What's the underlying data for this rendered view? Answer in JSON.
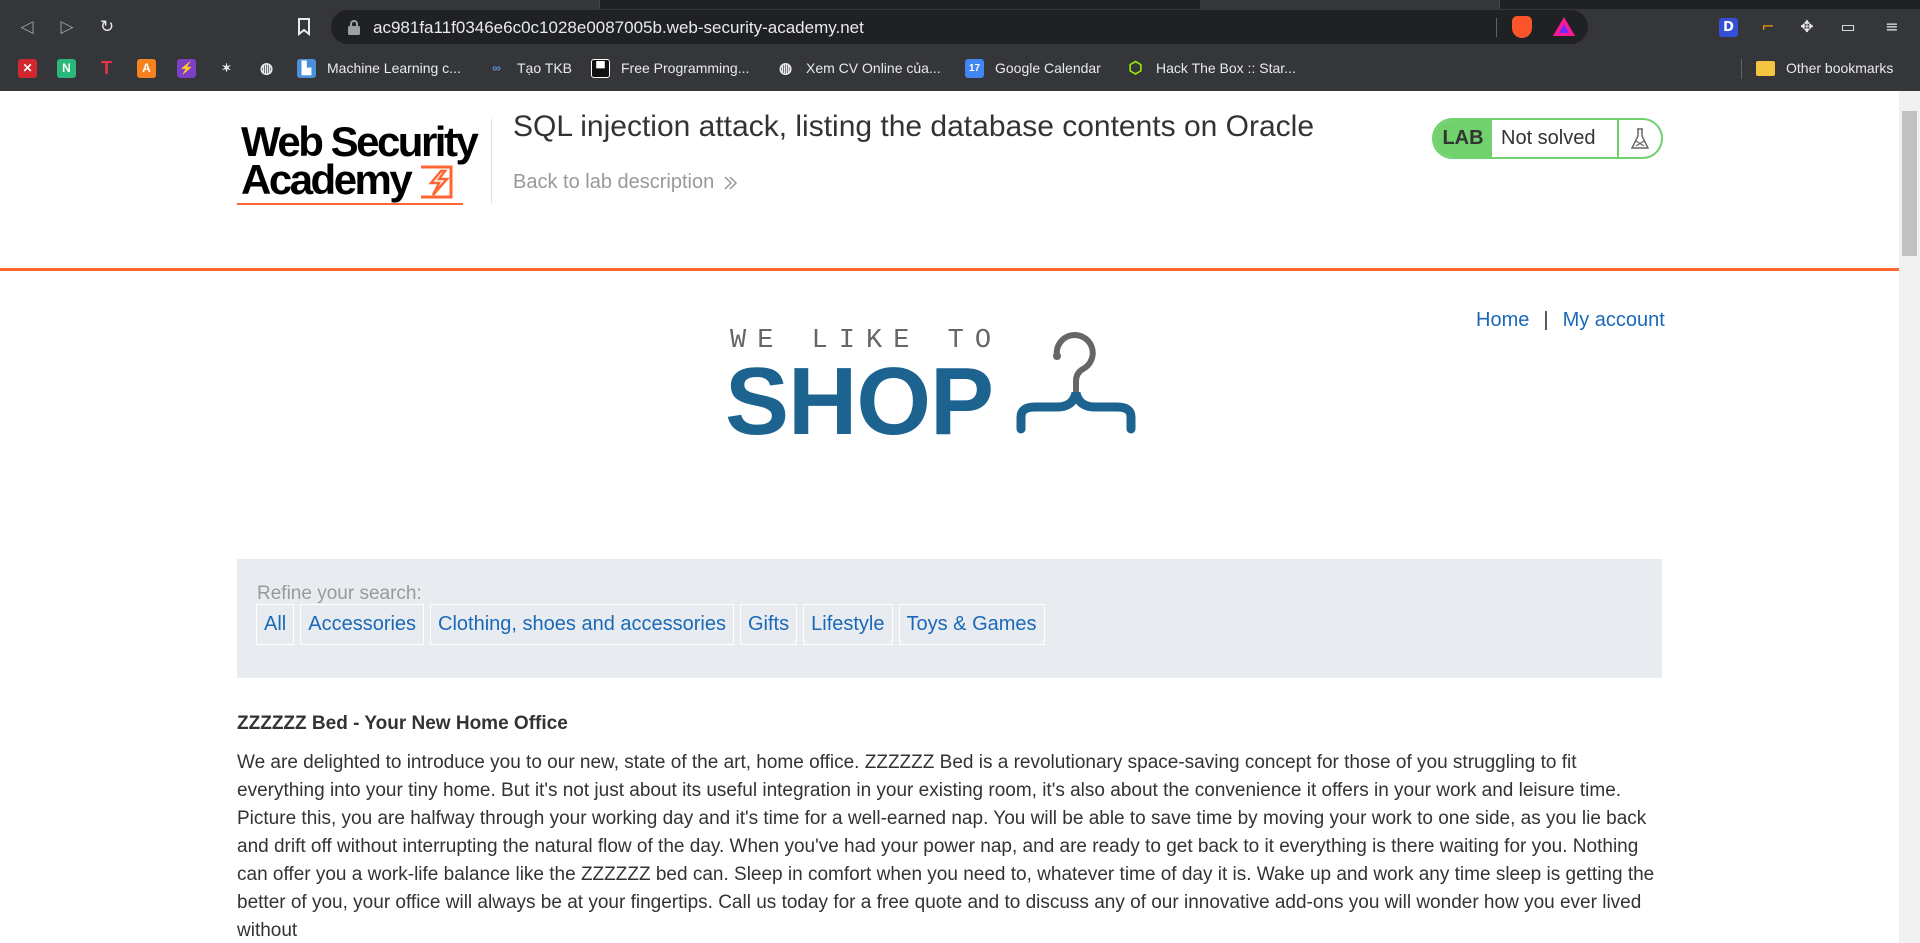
{
  "browser": {
    "url": "ac981fa11f0346e6c0c1028e0087005b.web-security-academy.net",
    "bookmarks": [
      {
        "label": "",
        "icon": "red-x-icon"
      },
      {
        "label": "",
        "icon": "notion-n-icon"
      },
      {
        "label": "",
        "icon": "red-t-icon"
      },
      {
        "label": "",
        "icon": "orange-a-icon"
      },
      {
        "label": "",
        "icon": "purple-bolt-icon"
      },
      {
        "label": "",
        "icon": "wolf-icon"
      },
      {
        "label": "",
        "icon": "globe-icon"
      },
      {
        "label": "Machine Learning c...",
        "icon": "chart-icon"
      },
      {
        "label": "Tạo TKB",
        "icon": "swirl-icon"
      },
      {
        "label": "Free Programming...",
        "icon": "book-icon"
      },
      {
        "label": "Xem CV Online của...",
        "icon": "globe-icon"
      },
      {
        "label": "Google Calendar",
        "icon": "calendar-icon"
      },
      {
        "label": "Hack The Box :: Star...",
        "icon": "cube-icon"
      }
    ],
    "other_bookmarks": "Other bookmarks"
  },
  "lab": {
    "logo_line1": "Web Security",
    "logo_line2": "Academy",
    "title": "SQL injection attack, listing the database contents on Oracle",
    "back_link": "Back to lab description",
    "status_label": "LAB",
    "status_value": "Not solved"
  },
  "nav": {
    "home": "Home",
    "separator": "|",
    "account": "My account"
  },
  "shop_logo": {
    "tagline": "WE LIKE TO",
    "word": "SHOP"
  },
  "filters": {
    "label": "Refine your search:",
    "categories": [
      "All",
      "Accessories",
      "Clothing, shoes and accessories",
      "Gifts",
      "Lifestyle",
      "Toys & Games"
    ]
  },
  "product": {
    "title": "ZZZZZZ Bed - Your New Home Office",
    "description": "We are delighted to introduce you to our new, state of the art, home office. ZZZZZZ Bed is a revolutionary space-saving concept for those of you struggling to fit everything into your tiny home. But it's not just about its useful integration in your existing room, it's also about the convenience it offers in your work and leisure time. Picture this, you are halfway through your working day and it's time for a well-earned nap. You will be able to save time by moving your work to one side, as you lie back and drift off without interrupting the natural flow of the day. When you've had your power nap, and are ready to get back to it everything is there waiting for you. Nothing can offer you a work-life balance like the ZZZZZZ bed can. Sleep in comfort when you need to, whatever time of day it is. Wake up and work any time sleep is getting the better of you, your office will always be at your fingertips. Call us today for a free quote and to discuss any of our innovative add-ons you will wonder how you ever lived without"
  },
  "colors": {
    "accent": "#ff6633",
    "link": "#1a69b8",
    "lab_green": "#70d16d",
    "shop_blue": "#1c6390",
    "filter_bg": "#e8ecf0"
  }
}
